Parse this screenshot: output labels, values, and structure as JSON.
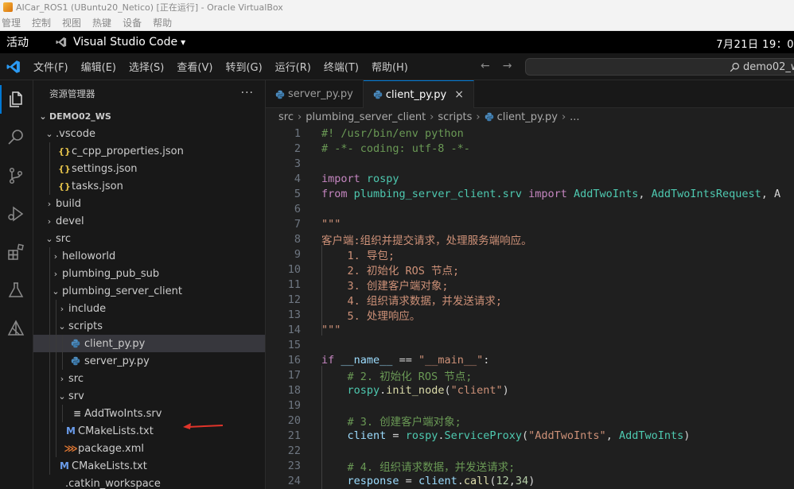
{
  "vbox": {
    "title": "AICar_ROS1 (UBuntu20_Netico) [正在运行] - Oracle VirtualBox",
    "menu": [
      "管理",
      "控制",
      "视图",
      "热键",
      "设备",
      "帮助"
    ]
  },
  "gnome": {
    "activities": "活动",
    "app_name": "Visual Studio Code",
    "app_menu_caret": "▾",
    "clock": "7月21日 19：0"
  },
  "vscode": {
    "menu": [
      "文件(F)",
      "编辑(E)",
      "选择(S)",
      "查看(V)",
      "转到(G)",
      "运行(R)",
      "终端(T)",
      "帮助(H)"
    ],
    "nav_back": "←",
    "nav_forward": "→",
    "command_center": "demo02_w",
    "sidebar": {
      "title": "资源管理器",
      "more": "···",
      "root": "DEMO02_WS",
      "tree": [
        {
          "label": ".vscode",
          "depth": 1,
          "type": "folder-open"
        },
        {
          "label": "c_cpp_properties.json",
          "depth": 2,
          "type": "json"
        },
        {
          "label": "settings.json",
          "depth": 2,
          "type": "json"
        },
        {
          "label": "tasks.json",
          "depth": 2,
          "type": "json"
        },
        {
          "label": "build",
          "depth": 1,
          "type": "folder-closed"
        },
        {
          "label": "devel",
          "depth": 1,
          "type": "folder-closed"
        },
        {
          "label": "src",
          "depth": 1,
          "type": "folder-open"
        },
        {
          "label": "helloworld",
          "depth": 2,
          "type": "folder-closed"
        },
        {
          "label": "plumbing_pub_sub",
          "depth": 2,
          "type": "folder-closed"
        },
        {
          "label": "plumbing_server_client",
          "depth": 2,
          "type": "folder-open"
        },
        {
          "label": "include",
          "depth": 3,
          "type": "folder-closed"
        },
        {
          "label": "scripts",
          "depth": 3,
          "type": "folder-open"
        },
        {
          "label": "client_py.py",
          "depth": 4,
          "type": "py",
          "selected": true
        },
        {
          "label": "server_py.py",
          "depth": 4,
          "type": "py"
        },
        {
          "label": "src",
          "depth": 3,
          "type": "folder-closed"
        },
        {
          "label": "srv",
          "depth": 3,
          "type": "folder-open"
        },
        {
          "label": "AddTwoInts.srv",
          "depth": 4,
          "type": "srv"
        },
        {
          "label": "CMakeLists.txt",
          "depth": 3,
          "type": "cmake"
        },
        {
          "label": "package.xml",
          "depth": 3,
          "type": "xml"
        },
        {
          "label": "CMakeLists.txt",
          "depth": 2,
          "type": "cmake"
        },
        {
          "label": ".catkin_workspace",
          "depth": 1,
          "type": "file"
        }
      ]
    },
    "tabs": [
      {
        "label": "server_py.py",
        "active": false
      },
      {
        "label": "client_py.py",
        "active": true,
        "close": "×"
      }
    ],
    "breadcrumbs": [
      "src",
      "plumbing_server_client",
      "scripts",
      "client_py.py",
      "..."
    ],
    "code": [
      {
        "n": "1",
        "segs": [
          [
            "c",
            "#! /usr/bin/env python"
          ]
        ]
      },
      {
        "n": "2",
        "segs": [
          [
            "c",
            "# -*- coding: utf-8 -*-"
          ]
        ]
      },
      {
        "n": "3",
        "segs": []
      },
      {
        "n": "4",
        "segs": [
          [
            "k",
            "import"
          ],
          [
            "p",
            " "
          ],
          [
            "m",
            "rospy"
          ]
        ]
      },
      {
        "n": "5",
        "segs": [
          [
            "k",
            "from"
          ],
          [
            "p",
            " "
          ],
          [
            "m",
            "plumbing_server_client.srv"
          ],
          [
            "p",
            " "
          ],
          [
            "k",
            "import"
          ],
          [
            "p",
            " "
          ],
          [
            "t",
            "AddTwoInts"
          ],
          [
            "p",
            ", "
          ],
          [
            "t",
            "AddTwoIntsRequest"
          ],
          [
            "p",
            ", A"
          ]
        ]
      },
      {
        "n": "6",
        "segs": []
      },
      {
        "n": "7",
        "segs": [
          [
            "s",
            "\"\"\""
          ]
        ]
      },
      {
        "n": "8",
        "segs": [
          [
            "s",
            "客户端:组织并提交请求，处理服务端响应。"
          ]
        ]
      },
      {
        "n": "9",
        "segs": [
          [
            "s",
            "    1. 导包;"
          ]
        ]
      },
      {
        "n": "10",
        "segs": [
          [
            "s",
            "    2. 初始化 ROS 节点;"
          ]
        ]
      },
      {
        "n": "11",
        "segs": [
          [
            "s",
            "    3. 创建客户端对象;"
          ]
        ]
      },
      {
        "n": "12",
        "segs": [
          [
            "s",
            "    4. 组织请求数据，并发送请求;"
          ]
        ]
      },
      {
        "n": "13",
        "segs": [
          [
            "s",
            "    5. 处理响应。"
          ]
        ]
      },
      {
        "n": "14",
        "segs": [
          [
            "s",
            "\"\"\""
          ]
        ]
      },
      {
        "n": "15",
        "segs": []
      },
      {
        "n": "16",
        "segs": [
          [
            "k",
            "if"
          ],
          [
            "p",
            " "
          ],
          [
            "v",
            "__name__"
          ],
          [
            "p",
            " == "
          ],
          [
            "s",
            "\"__main__\""
          ],
          [
            "p",
            ":"
          ]
        ]
      },
      {
        "n": "17",
        "segs": [
          [
            "p",
            "    "
          ],
          [
            "c",
            "# 2. 初始化 ROS 节点;"
          ]
        ]
      },
      {
        "n": "18",
        "segs": [
          [
            "p",
            "    "
          ],
          [
            "m",
            "rospy"
          ],
          [
            "p",
            "."
          ],
          [
            "f",
            "init_node"
          ],
          [
            "p",
            "("
          ],
          [
            "s",
            "\"client\""
          ],
          [
            "p",
            ")"
          ]
        ]
      },
      {
        "n": "19",
        "segs": []
      },
      {
        "n": "20",
        "segs": [
          [
            "p",
            "    "
          ],
          [
            "c",
            "# 3. 创建客户端对象;"
          ]
        ]
      },
      {
        "n": "21",
        "segs": [
          [
            "p",
            "    "
          ],
          [
            "v",
            "client"
          ],
          [
            "p",
            " = "
          ],
          [
            "m",
            "rospy"
          ],
          [
            "p",
            "."
          ],
          [
            "t",
            "ServiceProxy"
          ],
          [
            "p",
            "("
          ],
          [
            "s",
            "\"AddTwoInts\""
          ],
          [
            "p",
            ", "
          ],
          [
            "t",
            "AddTwoInts"
          ],
          [
            "p",
            ")"
          ]
        ]
      },
      {
        "n": "22",
        "segs": []
      },
      {
        "n": "23",
        "segs": [
          [
            "p",
            "    "
          ],
          [
            "c",
            "# 4. 组织请求数据，并发送请求;"
          ]
        ]
      },
      {
        "n": "24",
        "segs": [
          [
            "p",
            "    "
          ],
          [
            "v",
            "response"
          ],
          [
            "p",
            " = "
          ],
          [
            "v",
            "client"
          ],
          [
            "p",
            "."
          ],
          [
            "f",
            "call"
          ],
          [
            "p",
            "("
          ],
          [
            "n",
            "12"
          ],
          [
            "p",
            ","
          ],
          [
            "n",
            "34"
          ],
          [
            "p",
            ")"
          ]
        ]
      }
    ]
  },
  "colors": {
    "accent": "#0078d4",
    "annotation_arrow": "#e0342a"
  }
}
